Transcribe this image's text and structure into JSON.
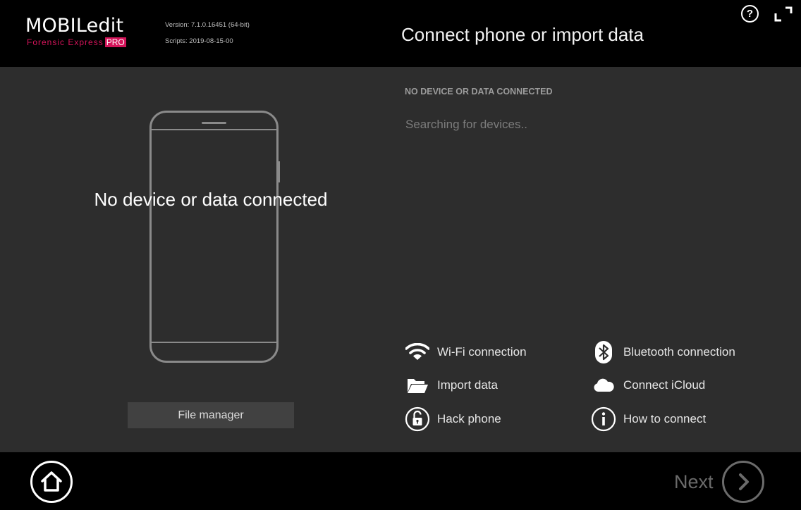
{
  "header": {
    "logo_main": "MOBILedit",
    "logo_sub": "Forensic Express",
    "logo_badge": "PRO",
    "version": "Version: 7.1.0.16451 (64-bit)",
    "scripts": "Scripts: 2019-08-15-00",
    "title": "Connect phone or import data",
    "help_label": "?",
    "help_icon": "question-icon",
    "fullscreen_icon": "fullscreen-icon"
  },
  "left": {
    "no_device_text": "No device or data connected",
    "file_manager_label": "File manager",
    "phone_icon": "phone-outline-icon"
  },
  "right": {
    "status_label": "NO DEVICE OR DATA CONNECTED",
    "searching_text": "Searching for devices.."
  },
  "actions": {
    "wifi": {
      "label": "Wi-Fi connection",
      "icon": "wifi-icon"
    },
    "import": {
      "label": "Import data",
      "icon": "folder-icon"
    },
    "hack": {
      "label": "Hack phone",
      "icon": "unlock-icon"
    },
    "bluetooth": {
      "label": "Bluetooth connection",
      "icon": "bluetooth-icon"
    },
    "icloud": {
      "label": "Connect iCloud",
      "icon": "cloud-icon"
    },
    "howto": {
      "label": "How to connect",
      "icon": "info-icon"
    }
  },
  "footer": {
    "home_icon": "home-icon",
    "next_label": "Next",
    "next_icon": "chevron-right-icon"
  },
  "colors": {
    "background": "#2d2d2d",
    "header_bg": "#000000",
    "brand_accent": "#d4145a",
    "disabled_text": "#6b6b6b"
  }
}
